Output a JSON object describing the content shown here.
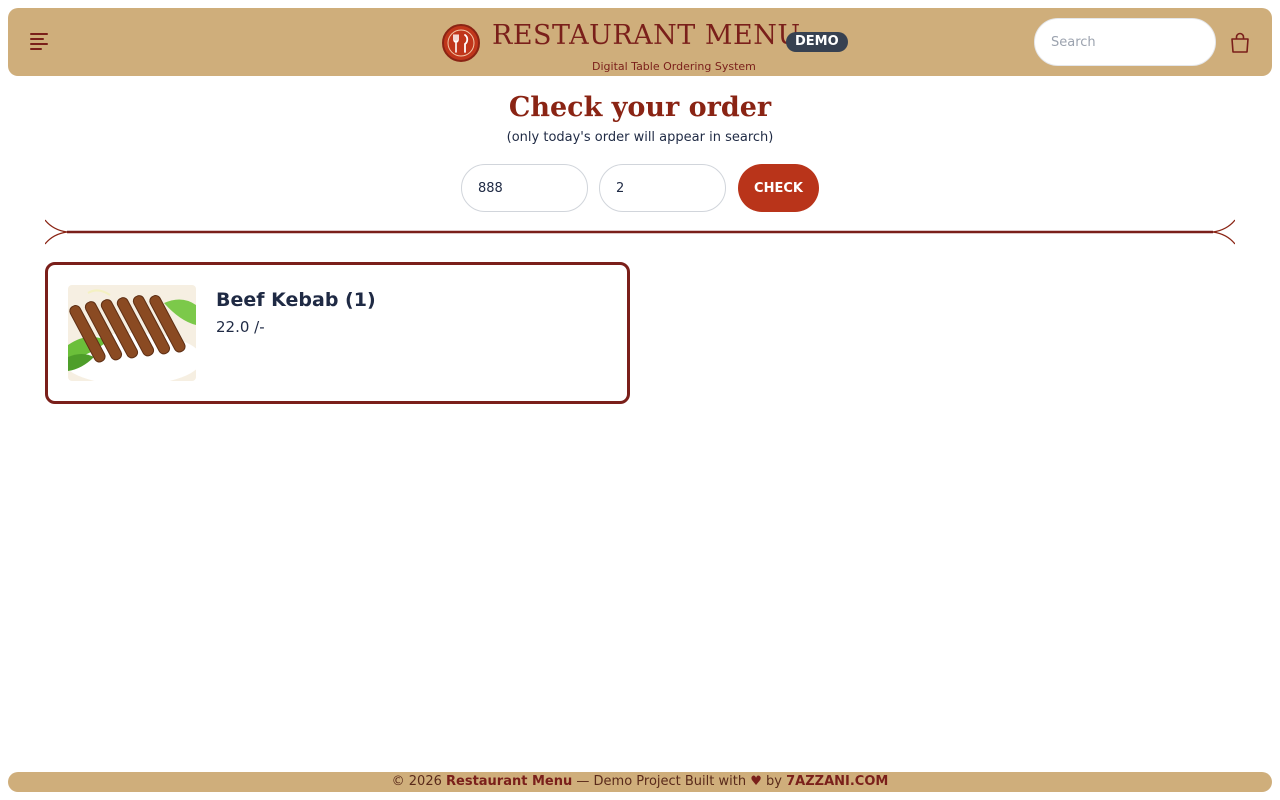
{
  "header": {
    "brand_title": "RESTAURANT MENU",
    "badge": "DEMO",
    "subtitle": "Digital Table Ordering System",
    "search_placeholder": "Search"
  },
  "main": {
    "title": "Check your order",
    "subtitle": "(only today's order will appear in search)",
    "order_number_value": "888",
    "table_number_value": "2",
    "check_label": "CHECK"
  },
  "orders": [
    {
      "name": "Beef Kebab (1)",
      "price": "22.0 /-"
    }
  ],
  "footer": {
    "prefix": "© 2026",
    "brand": "Restaurant Menu",
    "middle": "— Demo Project Built with",
    "heart": "♥",
    "by": "by",
    "author": "7AZZANI.COM"
  },
  "colors": {
    "header_bg": "#cfae7b",
    "brand": "#7a1f1a",
    "accent": "#b9341a",
    "badge_bg": "#374151"
  }
}
